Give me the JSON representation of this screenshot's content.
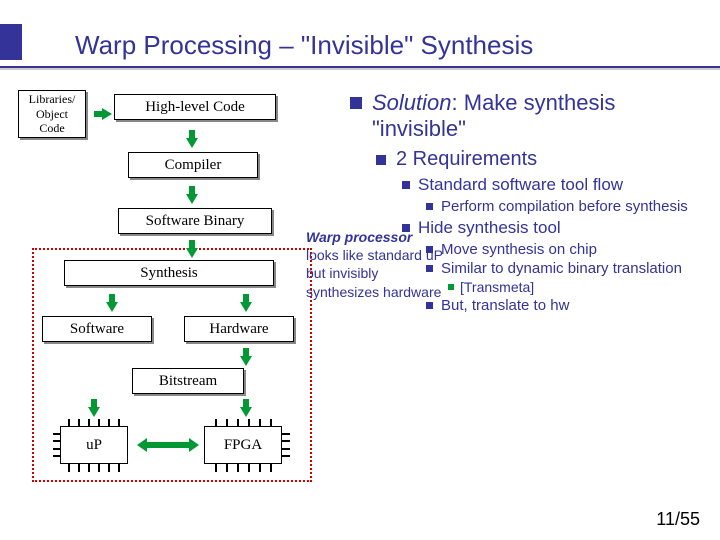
{
  "title": "Warp Processing – \"Invisible\" Synthesis",
  "diagram": {
    "libraries": "Libraries/\nObject\nCode",
    "highlevel": "High-level Code",
    "compiler": "Compiler",
    "swbinary": "Software Binary",
    "synthesis": "Synthesis",
    "software": "Software",
    "hardware": "Hardware",
    "bitstream": "Bitstream",
    "up": "uP",
    "fpga": "FPGA"
  },
  "annotation": {
    "l1": "Warp processor",
    "l2": "looks like standard uP but invisibly synthesizes hardware"
  },
  "bullets": {
    "solution_prefix": "Solution",
    "solution_rest": ": Make synthesis \"invisible\"",
    "req": "2 Requirements",
    "flow": "Standard software tool flow",
    "compile": "Perform compilation before synthesis",
    "hide": "Hide synthesis tool",
    "move": "Move synthesis on chip",
    "similar": "Similar to dynamic binary translation",
    "transmeta": "[Transmeta]",
    "but": "But, translate to hw"
  },
  "page": "11/55"
}
